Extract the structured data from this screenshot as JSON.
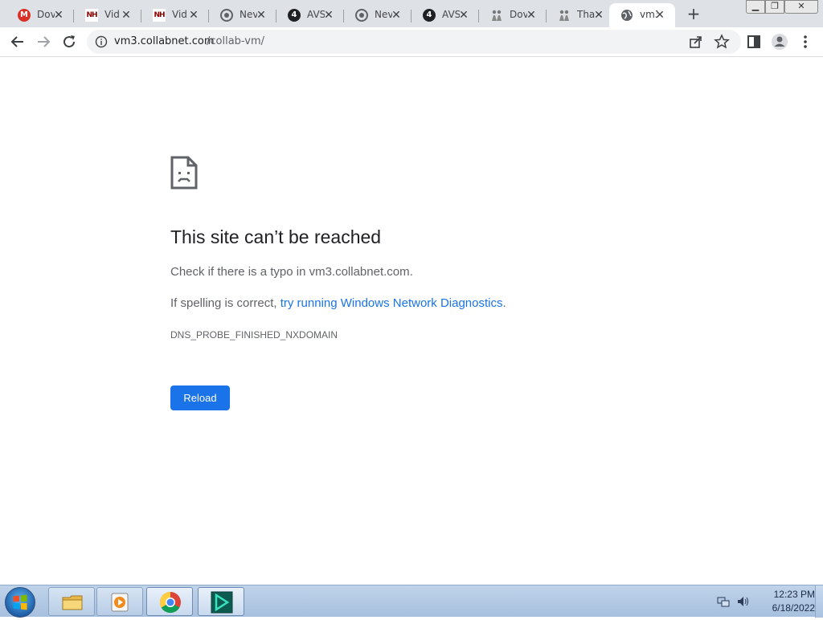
{
  "tabs": [
    {
      "title": "Dov",
      "icon": "mail-m-icon"
    },
    {
      "title": "Vid",
      "icon": "nh-logo-icon"
    },
    {
      "title": "Vid",
      "icon": "nh-logo-icon",
      "active": true
    },
    {
      "title": "Nev",
      "icon": "chrome-icon"
    },
    {
      "title": "AVS",
      "icon": "number-4-icon"
    },
    {
      "title": "Nev",
      "icon": "chrome-icon"
    },
    {
      "title": "AVS",
      "icon": "number-4-icon"
    },
    {
      "title": "Dov",
      "icon": "people-icon"
    },
    {
      "title": "Tha",
      "icon": "people-icon"
    },
    {
      "title": "vm3",
      "icon": "globe-icon",
      "current": true
    }
  ],
  "toolbar": {
    "url_host": "vm3.collabnet.com",
    "url_path": "/collab-vm/"
  },
  "error": {
    "title": "This site can’t be reached",
    "hint1": "Check if there is a typo in vm3.collabnet.com.",
    "hint2_prefix": "If spelling is correct, ",
    "hint2_link": "try running Windows Network Diagnostics",
    "hint2_suffix": ".",
    "code": "DNS_PROBE_FINISHED_NXDOMAIN",
    "reload_label": "Reload"
  },
  "taskbar": {
    "time": "12:23 PM",
    "date": "6/18/2022"
  },
  "colors": {
    "accent": "#1a73e8",
    "tabstrip": "#dee1e6",
    "taskbar": "#a7c0de"
  }
}
